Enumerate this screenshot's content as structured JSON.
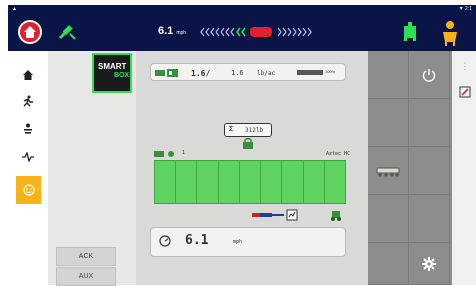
{
  "statusbar": {
    "left_text": "▲",
    "right_text": "▼ 2:1"
  },
  "topbar": {
    "speed_value": "6.1",
    "speed_unit": "mph",
    "colors": {
      "bar": "#0a1446",
      "home": "#e0202f",
      "guidance": "#2ee04f",
      "accent": "#f9b316"
    }
  },
  "nav": {
    "items": [
      {
        "icon": "home-icon"
      },
      {
        "icon": "work-icon"
      },
      {
        "icon": "person-icon"
      },
      {
        "icon": "signal-icon"
      },
      {
        "icon": "smiley-icon",
        "active": true
      }
    ]
  },
  "left_panel": {
    "smartbox_line1": "SMART",
    "smartbox_line2": "BOX",
    "ack_label": "ACK",
    "aux_label": "AUX"
  },
  "main": {
    "rate": {
      "actual": "1.6/",
      "target": "1.6",
      "unit": "lb/ac",
      "tank_percent": "100%"
    },
    "sum": {
      "symbol": "Σ",
      "value": "312lb"
    },
    "sections": {
      "number": "1",
      "product": "Aztec HC",
      "count": 9
    },
    "speed": {
      "value": "6.1",
      "unit": "mph"
    }
  },
  "right_grid": {
    "icons": [
      "power-icon",
      "implement-icon",
      "settings-gear-icon"
    ]
  },
  "edge": {
    "top_label": "⋮"
  }
}
